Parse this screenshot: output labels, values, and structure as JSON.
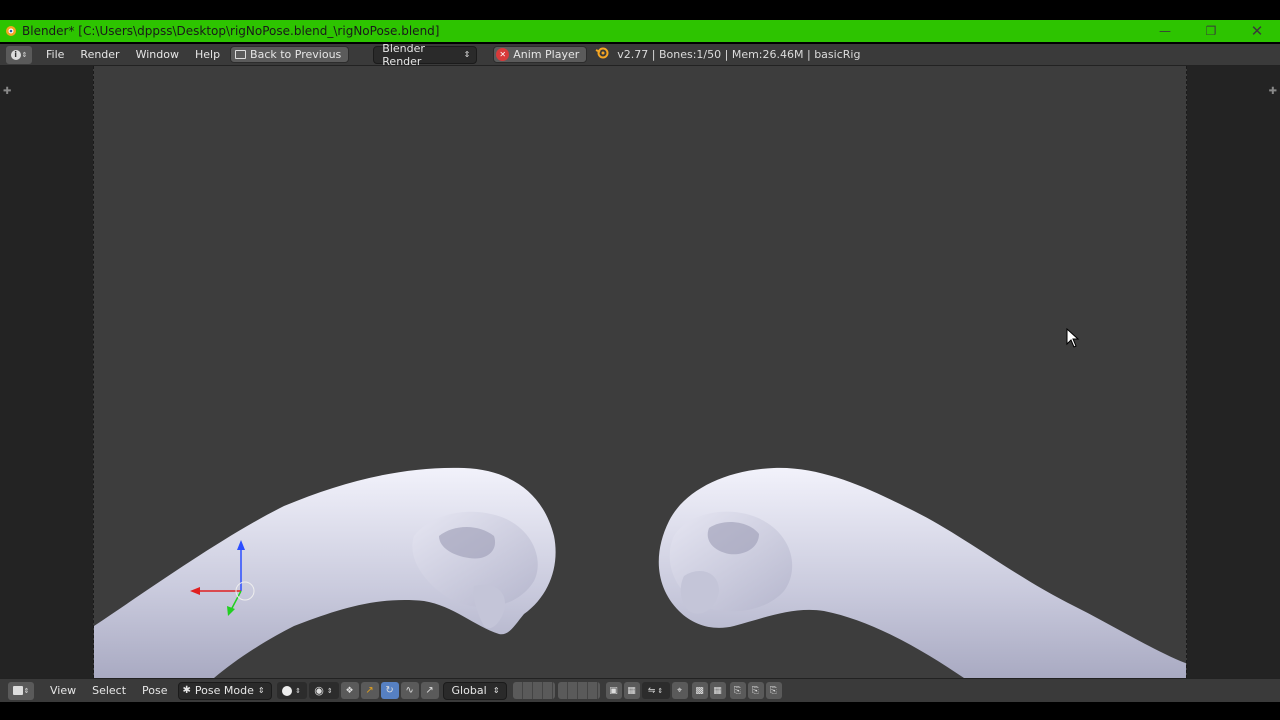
{
  "window": {
    "title": "Blender* [C:\\Users\\dppss\\Desktop\\rigNoPose.blend_\\rigNoPose.blend]",
    "accent_color": "#2dc400"
  },
  "menubar": {
    "menus": [
      "File",
      "Render",
      "Window",
      "Help"
    ],
    "back_label": "Back to Previous",
    "engine": "Blender Render",
    "scene_label": "Anim Player",
    "stats": "v2.77 | Bones:1/50 | Mem:26.46M | basicRig"
  },
  "bottombar": {
    "view": "View",
    "select": "Select",
    "pose": "Pose",
    "mode": "Pose Mode",
    "orientation": "Global"
  },
  "icons": [
    "blender-icon",
    "info-editor-icon",
    "back-icon",
    "close-circle-icon",
    "scene-icon",
    "view3d-editor-icon",
    "pose-mode-icon",
    "shading-icon",
    "pivot-icon",
    "manipulator-icon",
    "translate-icon",
    "rotate-icon",
    "scale-icon",
    "layers-icon",
    "lock-icon",
    "snap-icon",
    "render-icon"
  ]
}
